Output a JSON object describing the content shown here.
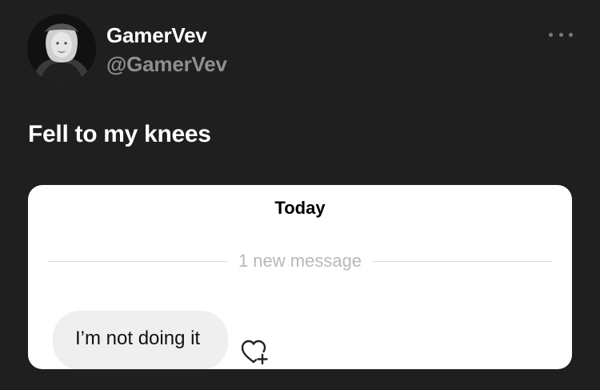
{
  "profile": {
    "display_name": "GamerVev",
    "handle": "@GamerVev",
    "avatar_icon": "profile-photo"
  },
  "header": {
    "more_icon": "more-options-icon"
  },
  "tweet": {
    "text": "Fell to my knees"
  },
  "embedded_chat": {
    "date_label": "Today",
    "divider_text": "1 new message",
    "messages": [
      {
        "text": "I’m not doing it"
      }
    ],
    "react_icon": "heart-plus-icon"
  },
  "colors": {
    "background": "#1f1f1f",
    "card": "#ffffff",
    "handle": "#8f8f8f",
    "bubble": "#efefef"
  }
}
